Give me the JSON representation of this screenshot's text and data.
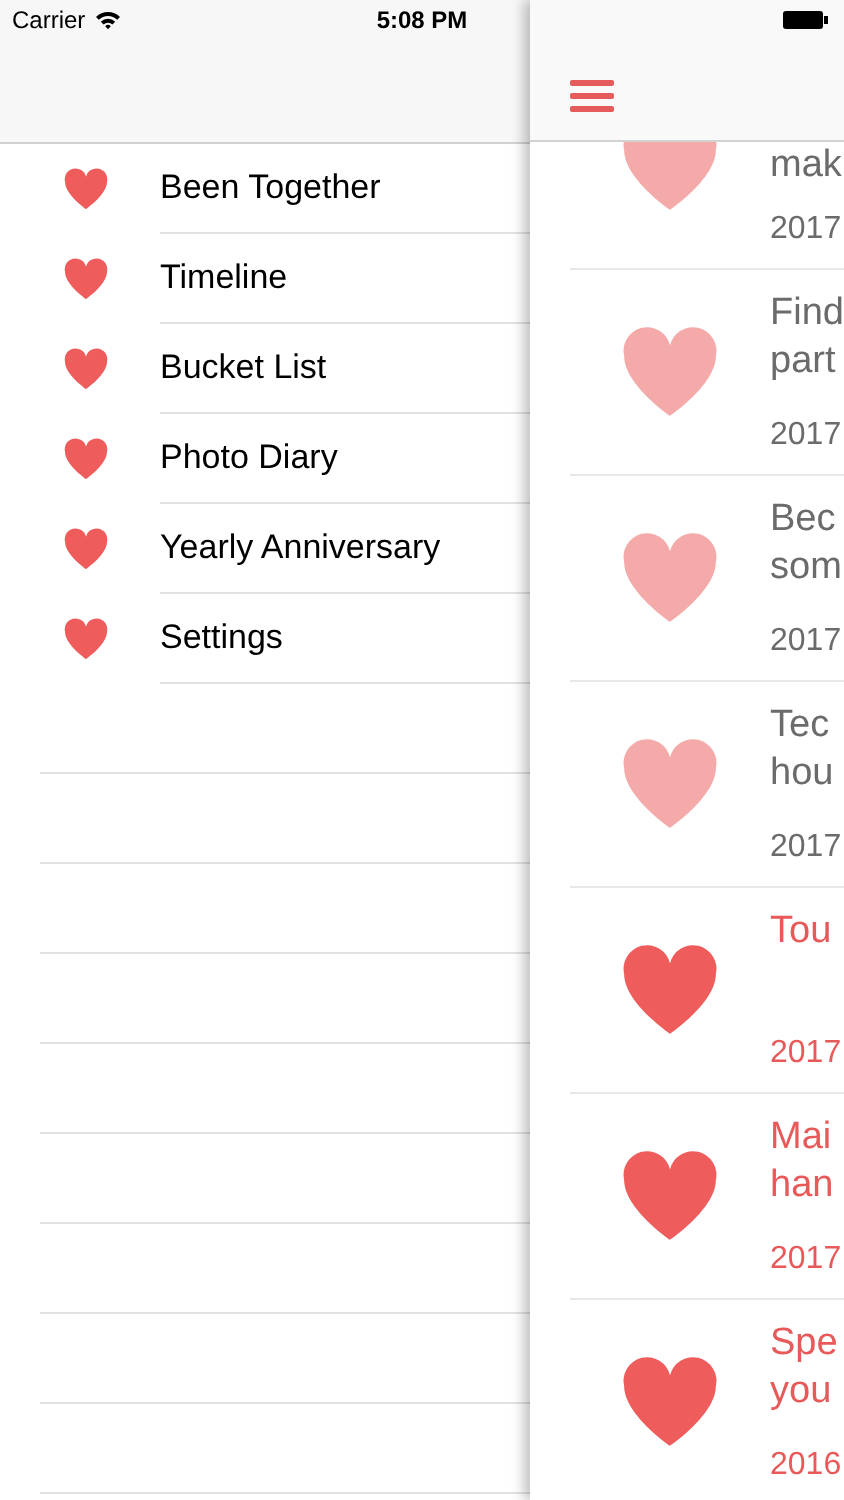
{
  "status_bar": {
    "carrier": "Carrier",
    "time": "5:08 PM"
  },
  "menu": {
    "items": [
      {
        "label": "Been Together"
      },
      {
        "label": "Timeline"
      },
      {
        "label": "Bucket List"
      },
      {
        "label": "Photo Diary"
      },
      {
        "label": "Yearly Anniversary"
      },
      {
        "label": "Settings"
      }
    ]
  },
  "timeline": {
    "entries": [
      {
        "lines": [
          "mak"
        ],
        "date": "2017",
        "done": false,
        "partial": true
      },
      {
        "lines": [
          "Find",
          "part"
        ],
        "date": "2017",
        "done": false,
        "partial": false
      },
      {
        "lines": [
          "Bec",
          "som"
        ],
        "date": "2017",
        "done": false,
        "partial": false
      },
      {
        "lines": [
          "Tec",
          "hou"
        ],
        "date": "2017",
        "done": false,
        "partial": false
      },
      {
        "lines": [
          "Tou"
        ],
        "date": "2017",
        "done": true,
        "partial": false
      },
      {
        "lines": [
          "Mai",
          "han"
        ],
        "date": "2017",
        "done": true,
        "partial": false
      },
      {
        "lines": [
          "Spe",
          "you"
        ],
        "date": "2016",
        "done": true,
        "partial": false
      }
    ]
  }
}
